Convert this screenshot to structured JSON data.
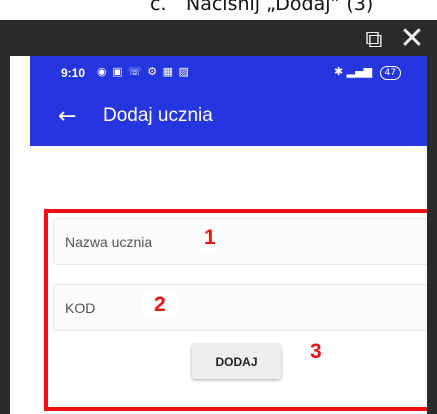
{
  "caption": {
    "number": "c.",
    "text": "Naciśnij „Dodaj” (3)"
  },
  "window": {
    "popout_icon": "popout-icon",
    "close_icon": "close-icon"
  },
  "statusbar": {
    "time": "9:10",
    "battery": "47"
  },
  "appbar": {
    "title": "Dodaj ucznia"
  },
  "form": {
    "name_placeholder": "Nazwa ucznia",
    "name_value": "",
    "code_placeholder": "KOD",
    "code_value": "",
    "add_label": "DODAJ"
  },
  "annotations": {
    "markers": [
      "1",
      "2",
      "3"
    ],
    "highlight_color": "#ee1111"
  },
  "colors": {
    "app_primary": "#2536e0"
  }
}
